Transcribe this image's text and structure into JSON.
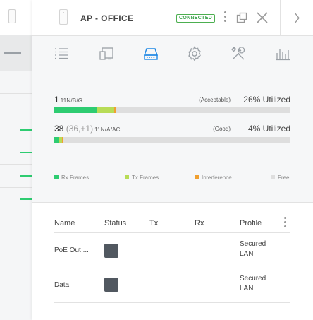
{
  "header": {
    "title": "AP - OFFICE",
    "badge": "CONNECTED",
    "device_icon": "access-point-icon",
    "next_icon": "chevron-right-icon"
  },
  "tabs": [
    {
      "name": "overview",
      "icon": "list-icon"
    },
    {
      "name": "devices",
      "icon": "devices-icon"
    },
    {
      "name": "radios",
      "icon": "radio-icon",
      "active": true
    },
    {
      "name": "configuration",
      "icon": "gear-icon"
    },
    {
      "name": "tools",
      "icon": "tools-icon"
    },
    {
      "name": "statistics",
      "icon": "stats-icon"
    }
  ],
  "radios": [
    {
      "channel": "1",
      "channel_extra": "",
      "band": "11N/B/G",
      "quality": "(Acceptable)",
      "utilization": "26% Utilized",
      "rx_frames_pct": 18,
      "tx_frames_pct": 7.5,
      "interference_pct": 0.7
    },
    {
      "channel": "38",
      "channel_extra": "(36,+1)",
      "band": "11N/A/AC",
      "quality": "(Good)",
      "utilization": "4% Utilized",
      "rx_frames_pct": 2.2,
      "tx_frames_pct": 1.0,
      "interference_pct": 0.6
    }
  ],
  "legend": [
    {
      "label": "Rx Frames",
      "color": "#2ecc71"
    },
    {
      "label": "Tx Frames",
      "color": "#b8dc57"
    },
    {
      "label": "Interference",
      "color": "#f0a030"
    },
    {
      "label": "Free",
      "color": "#dedede"
    }
  ],
  "ports_table": {
    "columns": [
      "Name",
      "Status",
      "Tx",
      "Rx",
      "Profile"
    ],
    "rows": [
      {
        "name": "PoE Out ...",
        "status_color": "#515860",
        "tx": "",
        "rx": "",
        "profile_line1": "Secured",
        "profile_line2": "LAN"
      },
      {
        "name": "Data",
        "status_color": "#515860",
        "tx": "",
        "rx": "",
        "profile_line1": "Secured",
        "profile_line2": "LAN"
      }
    ]
  },
  "colors": {
    "accent": "#1e88e5",
    "connected": "#3aa34a",
    "rx": "#2ecc71",
    "tx": "#b8dc57",
    "interference": "#f0a030",
    "free": "#dedede"
  }
}
